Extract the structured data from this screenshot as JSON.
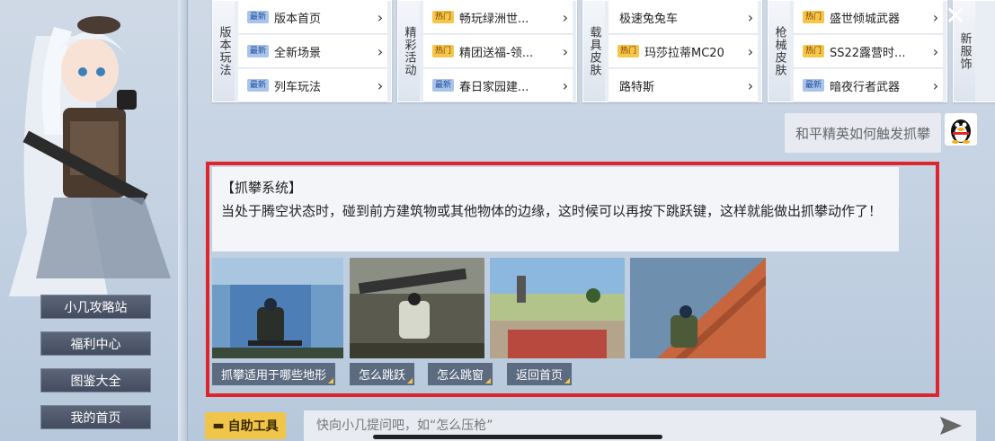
{
  "sidebar": {
    "items": [
      {
        "label": "小几攻略站"
      },
      {
        "label": "福利中心"
      },
      {
        "label": "图鉴大全"
      },
      {
        "label": "我的首页"
      }
    ]
  },
  "categories": [
    {
      "title": "版本玩法",
      "items": [
        {
          "badge": "最新",
          "label": "版本首页"
        },
        {
          "badge": "最新",
          "label": "全新场景"
        },
        {
          "badge": "最新",
          "label": "列车玩法"
        }
      ]
    },
    {
      "title": "精彩活动",
      "items": [
        {
          "badge": "热门",
          "label": "畅玩绿洲世..."
        },
        {
          "badge": "热门",
          "label": "精团送福-领..."
        },
        {
          "badge": "最新",
          "label": "春日家园建..."
        }
      ]
    },
    {
      "title": "载具皮肤",
      "items": [
        {
          "badge": "",
          "label": "极速兔兔车"
        },
        {
          "badge": "热门",
          "label": "玛莎拉蒂MC20"
        },
        {
          "badge": "",
          "label": "路特斯"
        }
      ]
    },
    {
      "title": "枪械皮肤",
      "items": [
        {
          "badge": "热门",
          "label": "盛世倾城武器"
        },
        {
          "badge": "热门",
          "label": "SS22露营时..."
        },
        {
          "badge": "最新",
          "label": "暗夜行者武器"
        }
      ]
    },
    {
      "title": "新服饰",
      "items": []
    }
  ],
  "chat": {
    "user_question": "和平精英如何触发抓攀",
    "answer_title": "【抓攀系统】",
    "answer_body": "当处于腾空状态时，碰到前方建筑物或其他物体的边缘，这时候可以再按下跳跃键，这样就能做出抓攀动作了！",
    "quick_replies": [
      {
        "label": "抓攀适用于哪些地形"
      },
      {
        "label": "怎么跳跃"
      },
      {
        "label": "怎么跳窗"
      },
      {
        "label": "返回首页"
      }
    ]
  },
  "bottom": {
    "tool_label": "自助工具",
    "input_placeholder": "快向小几提问吧，如“怎么压枪”"
  },
  "colors": {
    "highlight_border": "#e0242d",
    "badge_new": "#a9c3ea",
    "badge_hot": "#f5c64a",
    "tool_button": "#f1c54a"
  }
}
